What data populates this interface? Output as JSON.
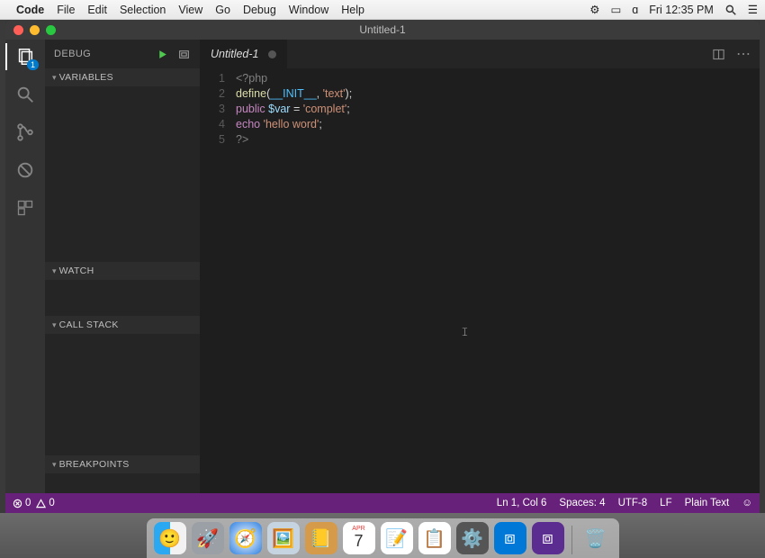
{
  "menubar": {
    "app": "Code",
    "items": [
      "File",
      "Edit",
      "Selection",
      "View",
      "Go",
      "Debug",
      "Window",
      "Help"
    ],
    "clock": "Fri 12:35 PM"
  },
  "window": {
    "title": "Untitled-1"
  },
  "activitybar": {
    "explorer_badge": "1"
  },
  "sidebar": {
    "title": "DEBUG",
    "sections": {
      "variables": "VARIABLES",
      "watch": "WATCH",
      "callstack": "CALL STACK",
      "breakpoints": "BREAKPOINTS"
    }
  },
  "editor": {
    "tab_label": "Untitled-1",
    "lines": [
      {
        "n": 1,
        "tokens": [
          [
            "open",
            "<?php"
          ]
        ]
      },
      {
        "n": 2,
        "tokens": [
          [
            "fn",
            "define"
          ],
          [
            "punc",
            "("
          ],
          [
            "const",
            "__INIT__"
          ],
          [
            "punc",
            ", "
          ],
          [
            "str",
            "'text'"
          ],
          [
            "punc",
            ");"
          ]
        ]
      },
      {
        "n": 3,
        "tokens": [
          [
            "kw",
            "public "
          ],
          [
            "var",
            "$var"
          ],
          [
            "punc",
            " = "
          ],
          [
            "str",
            "'complet'"
          ],
          [
            "punc",
            ";"
          ]
        ]
      },
      {
        "n": 4,
        "tokens": [
          [
            "kw",
            "echo "
          ],
          [
            "str",
            "'hello word'"
          ],
          [
            "punc",
            ";"
          ]
        ]
      },
      {
        "n": 5,
        "tokens": [
          [
            "open",
            "?>"
          ]
        ]
      }
    ]
  },
  "statusbar": {
    "errors": "0",
    "warnings": "0",
    "position": "Ln 1, Col 6",
    "spaces": "Spaces: 4",
    "encoding": "UTF-8",
    "eol": "LF",
    "language": "Plain Text"
  },
  "dock": {
    "apps": [
      "finder",
      "launchpad",
      "safari",
      "preview",
      "contacts",
      "calendar",
      "notes",
      "reminders",
      "settings",
      "vscode",
      "visualstudio"
    ],
    "trash": "trash",
    "calendar_day": "7",
    "calendar_month": "APR"
  }
}
